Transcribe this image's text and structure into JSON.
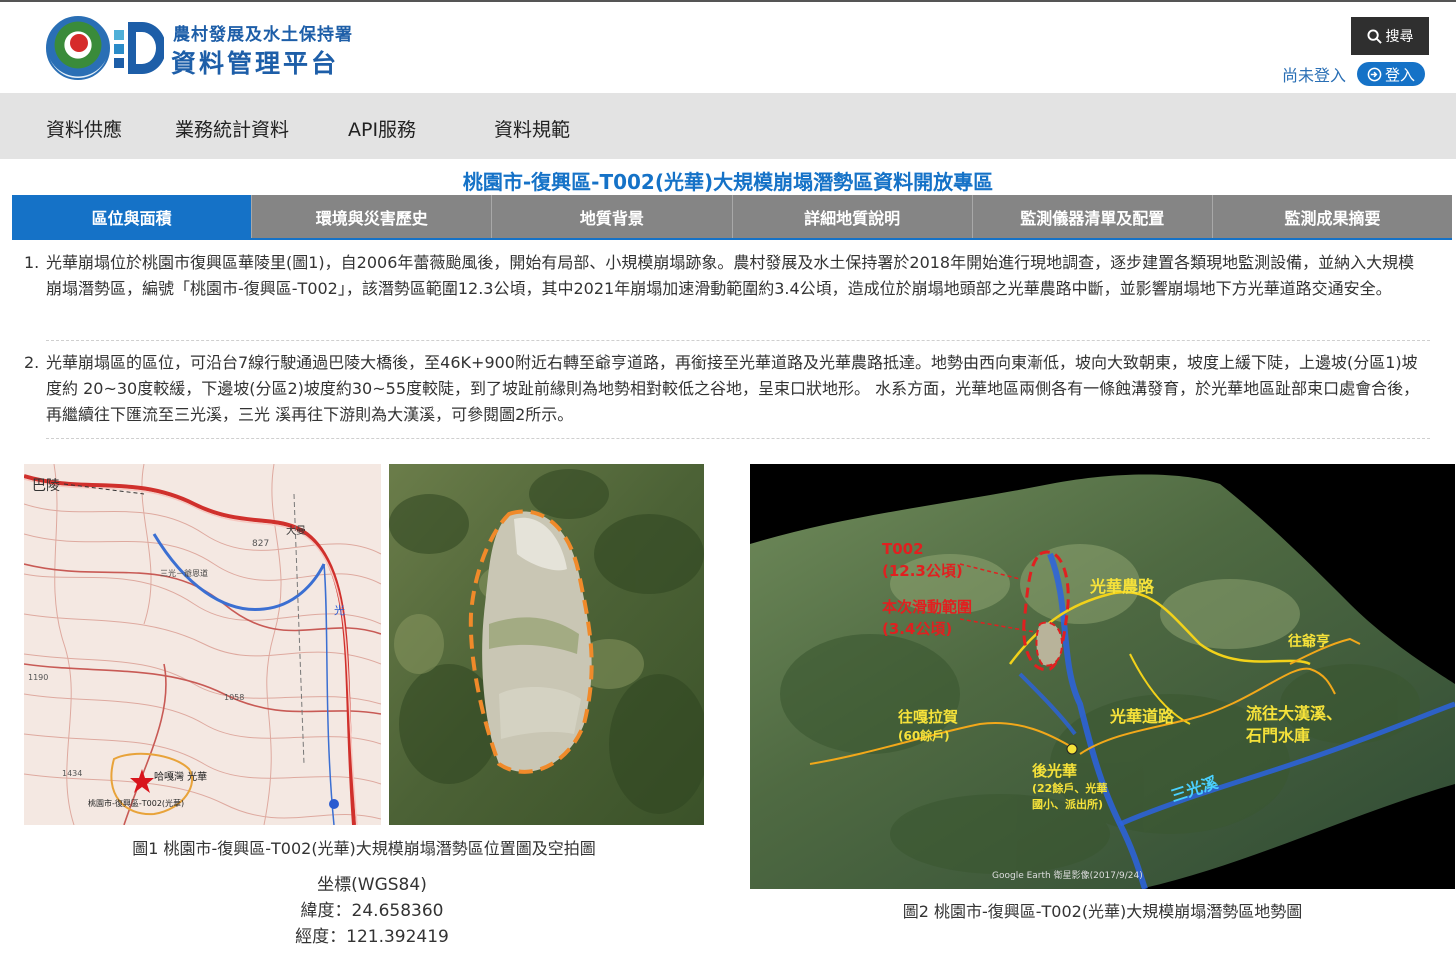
{
  "header": {
    "org_name": "農村發展及水土保持署",
    "platform_name": "資料管理平台",
    "search_label": "搜尋",
    "login_status": "尚未登入",
    "login_label": "登入"
  },
  "nav": {
    "items": [
      {
        "label": "資料供應"
      },
      {
        "label": "業務統計資料"
      },
      {
        "label": "API服務"
      },
      {
        "label": "資料規範"
      }
    ]
  },
  "page": {
    "title": "桃園市-復興區-T002(光華)大規模崩塌潛勢區資料開放專區"
  },
  "tabs": [
    {
      "label": "區位與面積",
      "active": true
    },
    {
      "label": "環境與災害歷史",
      "active": false
    },
    {
      "label": "地質背景",
      "active": false
    },
    {
      "label": "詳細地質說明",
      "active": false
    },
    {
      "label": "監測儀器清單及配置",
      "active": false
    },
    {
      "label": "監測成果摘要",
      "active": false
    }
  ],
  "paragraphs": [
    {
      "num": "1.",
      "text": "光華崩塌位於桃園市復興區華陵里(圖1)，自2006年蕾薇颱風後，開始有局部、小規模崩塌跡象。農村發展及水土保持署於2018年開始進行現地調查，逐步建置各類現地監測設備，並納入大規模崩塌潛勢區，編號「桃園市-復興區-T002」，該潛勢區範圍12.3公頃，其中2021年崩塌加速滑動範圍約3.4公頃，造成位於崩塌地頭部之光華農路中斷，並影響崩塌地下方光華道路交通安全。"
    },
    {
      "num": "2.",
      "text": "光華崩塌區的區位，可沿台7線行駛通過巴陵大橋後，至46K+900附近右轉至爺亨道路，再銜接至光華道路及光華農路抵達。地勢由西向東漸低，坡向大致朝東，坡度上緩下陡，上邊坡(分區1)坡度約 20~30度較緩，下邊坡(分區2)坡度約30~55度較陡，到了坡趾前緣則為地勢相對較低之谷地，呈束口狀地形。 水系方面，光華地區兩側各有一條蝕溝發育，於光華地區趾部束口處會合後，再繼續往下匯流至三光溪，三光 溪再往下游則為大漢溪，可參閱圖2所示。"
    }
  ],
  "figure1": {
    "map_labels": {
      "place_baling": "巴陵",
      "place_daman": "大曼",
      "elev_827": "827",
      "road_sanguang": "三光－爺恩道",
      "river_guang": "光",
      "place_guanghua": "哈嘎灣 光華",
      "zone_label": "桃園市-復興區-T002(光華)",
      "elev_1190": "1190",
      "elev_1058": "1058",
      "elev_1434": "1434"
    },
    "caption": "圖1 桃園市-復興區-T002(光華)大規模崩塌潛勢區位置圖及空拍圖"
  },
  "coordinates": {
    "system": "坐標(WGS84)",
    "latitude": "緯度：24.658360",
    "longitude": "經度：121.392419"
  },
  "figure2": {
    "labels": {
      "t002": "T002",
      "t002_area": "(12.3公頃)",
      "slide": "本次滑動範圍",
      "slide_area": "(3.4公頃)",
      "farm_road": "光華農路",
      "to_yeheng": "往爺亨",
      "to_gala": "往嘎拉賀",
      "gala_households": "(60餘戶)",
      "guanghua_road": "光華道路",
      "flow1": "流往大漢溪、",
      "flow2": "石門水庫",
      "hou_guanghua": "後光華",
      "hou_detail1": "(22餘戶、光華",
      "hou_detail2": "國小、派出所)",
      "river": "三光溪",
      "credit": "Google Earth 衛星影像(2017/9/24)"
    },
    "caption": "圖2 桃園市-復興區-T002(光華)大規模崩塌潛勢區地勢圖"
  },
  "colors": {
    "brand_blue": "#1572c7",
    "tab_gray": "#858585",
    "nav_bg": "#e3e3e3",
    "slide_red": "#e02020",
    "road_yellow": "#f2d21a"
  }
}
